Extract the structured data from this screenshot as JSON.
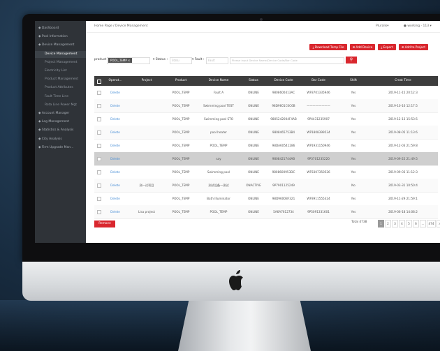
{
  "screen": {
    "breadcrumb": "Home Page / Device Management",
    "language": "Pluralis▾",
    "user": "● working · 113 ▾",
    "sidebar": [
      {
        "label": "◆ Dashboard",
        "sub": false,
        "active": false
      },
      {
        "label": "◆ Pool Information",
        "sub": false,
        "active": false
      },
      {
        "label": "◆ Device Management",
        "sub": false,
        "active": false
      },
      {
        "label": "Device Management",
        "sub": true,
        "active": true
      },
      {
        "label": "Project Management",
        "sub": true,
        "active": false
      },
      {
        "label": "Electricity List",
        "sub": true,
        "active": false
      },
      {
        "label": "Product Management",
        "sub": true,
        "active": false
      },
      {
        "label": "Product Attributes",
        "sub": true,
        "active": false
      },
      {
        "label": "Fault Time Line",
        "sub": true,
        "active": false
      },
      {
        "label": "Rota Line Power Mgt",
        "sub": true,
        "active": false
      },
      {
        "label": "◆ Account Manager",
        "sub": false,
        "active": false
      },
      {
        "label": "◆ Log Management",
        "sub": false,
        "active": false
      },
      {
        "label": "◆ Statistics & Analysis",
        "sub": false,
        "active": false
      },
      {
        "label": "◆ City Analysis",
        "sub": false,
        "active": false
      },
      {
        "label": "◆ Firm Upgrade Man...",
        "sub": false,
        "active": false
      }
    ],
    "buttons": {
      "download": "⤓ Download Temp File",
      "add_device": "⊕ Add Device",
      "export": "⤓ Export",
      "add_project": "⊕ Add to Project"
    },
    "filters": {
      "product_label": "product :",
      "product_tag": "POOL_TEMP ×",
      "status_label": "▾ Status :",
      "status_placeholder": "Statu",
      "fault_label": "▾ Fault :",
      "fault_placeholder": "Fault",
      "search_placeholder": "Please input Device Name/Device Code/Bar Code",
      "search_icon": "search-icon"
    },
    "columns": [
      "Operat...",
      "Project",
      "Product",
      "Device Name",
      "Status",
      "Device Code",
      "Bar Code",
      "Shift",
      "Creat Time"
    ],
    "rows": [
      {
        "op": "Delete",
        "project": "",
        "product": "POOL_TEMP",
        "name": "Fault A",
        "status": "ONLINE",
        "code": "9808600413AC",
        "bar": "WP3701335946",
        "shift": "Yes",
        "time": "2019-11-15 20:12:3"
      },
      {
        "op": "Delete",
        "project": "",
        "product": "POOL_TEMP",
        "name": "Swimming pool TEST",
        "status": "ONLINE",
        "code": "98D9601C0C6B",
        "bar": "————————",
        "shift": "Yes",
        "time": "2019-10-16 12:17:5"
      },
      {
        "op": "Delete",
        "project": "",
        "product": "POOL_TEMP",
        "name": "Swimming pool STO",
        "status": "ONLINE",
        "code": "9805242004F4AB",
        "bar": "9P4431235907",
        "shift": "Yes",
        "time": "2019-12-13 15:53:5"
      },
      {
        "op": "Delete",
        "project": "",
        "product": "POOL_TEMP",
        "name": "pool heater",
        "status": "ONLINE",
        "code": "9808465753B4",
        "bar": "WP1808399534",
        "shift": "Yes",
        "time": "2019-08-05 11:13:6"
      },
      {
        "op": "Delete",
        "project": "",
        "product": "POOL_TEMP",
        "name": "POOL_TEMP",
        "status": "ONLINE",
        "code": "98DA60541286",
        "bar": "WP1931150946",
        "shift": "Yes",
        "time": "2019-12-03 21:59:8"
      },
      {
        "op": "Delete",
        "project": "",
        "product": "POOL_TEMP",
        "name": "say",
        "status": "ONLINE",
        "code": "9808421744AB",
        "bar": "9P3701235220",
        "shift": "Yes",
        "time": "2019-09-22 21:49:5"
      },
      {
        "op": "Delete",
        "project": "",
        "product": "POOL_TEMP",
        "name": "Swimming pool",
        "status": "ONLINE",
        "code": "9808600953DC",
        "bar": "WP3307350526",
        "shift": "Yes",
        "time": "2019-09-03 11:12:3"
      },
      {
        "op": "Delete",
        "project": "测—试项目",
        "product": "POOL_TEMP",
        "name": "测试设备—测试",
        "status": "ONACTIVE",
        "code": "9P7901125249",
        "bar": "",
        "shift": "No",
        "time": "2019-03-31 10:50:4"
      },
      {
        "op": "Delete",
        "project": "",
        "product": "POOL_TEMP",
        "name": "Bath Illuminator",
        "status": "ONLINE",
        "code": "98D9600BF321",
        "bar": "WP3911555324",
        "shift": "Yes",
        "time": "2019-11-29 21:59:1"
      },
      {
        "op": "Delete",
        "project": "Lisa project",
        "product": "POOL_TEMP",
        "name": "POOL_TEMP",
        "status": "ONLINE",
        "code": "5A6A7612734",
        "bar": "9P5091331601",
        "shift": "Yes",
        "time": "2019-06-18 14:08:2"
      }
    ],
    "highlight_row_index": 5,
    "remove_label": "Remove",
    "pagination": {
      "total": "Total 4738",
      "pages": [
        "1",
        "2",
        "3",
        "4",
        "5",
        "6",
        "...",
        "474",
        ">"
      ],
      "current": "1",
      "goto": "Go to"
    }
  },
  "colors": {
    "accent": "#d9272e",
    "sidebar": "#2f3338",
    "header": "#3d3d3d"
  }
}
